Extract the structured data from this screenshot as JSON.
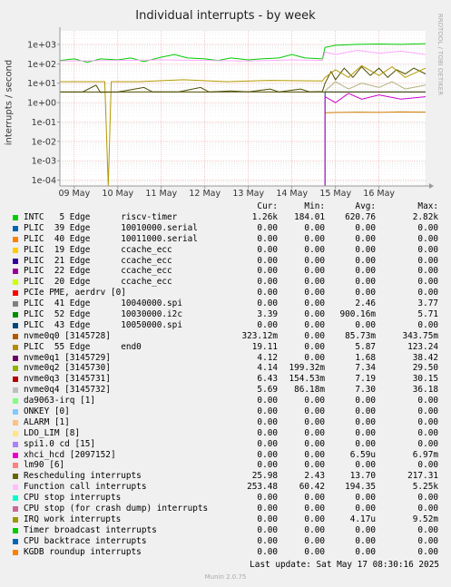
{
  "chart_data": {
    "type": "line",
    "title": "Individual interrupts - by week",
    "ylabel": "interrupts / second",
    "y_scale": "log",
    "ylim": [
      5e-05,
      5000
    ],
    "y_ticks": [
      {
        "v": 1000,
        "label": "1e+03"
      },
      {
        "v": 100,
        "label": "1e+02"
      },
      {
        "v": 10,
        "label": "1e+01"
      },
      {
        "v": 1,
        "label": "1e+00"
      },
      {
        "v": 0.1,
        "label": "1e-01"
      },
      {
        "v": 0.01,
        "label": "1e-02"
      },
      {
        "v": 0.001,
        "label": "1e-03"
      },
      {
        "v": 0.0001,
        "label": "1e-04"
      }
    ],
    "xlim": [
      -0.33,
      8.07
    ],
    "x_ticks": [
      {
        "v": 0,
        "label": "09 May"
      },
      {
        "v": 1,
        "label": "10 May"
      },
      {
        "v": 2,
        "label": "11 May"
      },
      {
        "v": 3,
        "label": "12 May"
      },
      {
        "v": 4,
        "label": "13 May"
      },
      {
        "v": 5,
        "label": "14 May"
      },
      {
        "v": 6,
        "label": "15 May"
      },
      {
        "v": 7,
        "label": "16 May"
      }
    ],
    "grid": true,
    "series": [
      {
        "name": "Rescheduling interrupts",
        "color": "#4d4d00",
        "points": [
          [
            -0.33,
            3.5
          ],
          [
            0.2,
            3.6
          ],
          [
            0.5,
            8
          ],
          [
            0.6,
            3.4
          ],
          [
            1,
            3.5
          ],
          [
            1.6,
            6
          ],
          [
            1.8,
            3.5
          ],
          [
            2.4,
            3.6
          ],
          [
            2.9,
            6
          ],
          [
            3.1,
            3.5
          ],
          [
            3.6,
            4
          ],
          [
            4,
            3.6
          ],
          [
            4.5,
            5
          ],
          [
            4.7,
            3.5
          ],
          [
            5.2,
            5
          ],
          [
            5.4,
            3.6
          ],
          [
            5.7,
            3.7
          ],
          [
            5.76,
            10
          ],
          [
            5.9,
            40
          ],
          [
            6.0,
            15
          ],
          [
            6.2,
            60
          ],
          [
            6.4,
            20
          ],
          [
            6.6,
            70
          ],
          [
            6.8,
            25
          ],
          [
            7.0,
            60
          ],
          [
            7.2,
            20
          ],
          [
            7.4,
            50
          ],
          [
            7.6,
            30
          ],
          [
            7.8,
            60
          ],
          [
            8.07,
            30
          ]
        ]
      },
      {
        "name": "INTC 5 Edge riscv-timer",
        "color": "#00cc00",
        "points": [
          [
            -0.33,
            150
          ],
          [
            0,
            180
          ],
          [
            0.3,
            120
          ],
          [
            0.6,
            180
          ],
          [
            1,
            160
          ],
          [
            1.3,
            200
          ],
          [
            1.6,
            130
          ],
          [
            2,
            220
          ],
          [
            2.3,
            300
          ],
          [
            2.6,
            200
          ],
          [
            3,
            180
          ],
          [
            3.3,
            150
          ],
          [
            3.6,
            200
          ],
          [
            4,
            160
          ],
          [
            4.3,
            180
          ],
          [
            4.7,
            200
          ],
          [
            5,
            300
          ],
          [
            5.3,
            200
          ],
          [
            5.7,
            180
          ],
          [
            5.76,
            700
          ],
          [
            6,
            900
          ],
          [
            6.5,
            1000
          ],
          [
            7,
            1050
          ],
          [
            7.5,
            1000
          ],
          [
            8.07,
            1100
          ]
        ]
      },
      {
        "name": "Function call interrupts",
        "color": "#ffa8ff",
        "points": [
          [
            -0.33,
            140
          ],
          [
            1,
            150
          ],
          [
            2,
            160
          ],
          [
            3,
            150
          ],
          [
            4,
            140
          ],
          [
            5,
            160
          ],
          [
            5.7,
            150
          ],
          [
            5.76,
            400
          ],
          [
            6,
            300
          ],
          [
            6.5,
            500
          ],
          [
            7,
            350
          ],
          [
            7.5,
            450
          ],
          [
            8.07,
            300
          ]
        ]
      },
      {
        "name": "nvme0q2 [3145730]",
        "color": "#b0b07a",
        "points": [
          [
            5.76,
            4
          ],
          [
            6,
            12
          ],
          [
            6.3,
            5
          ],
          [
            6.6,
            10
          ],
          [
            7,
            6
          ],
          [
            7.3,
            12
          ],
          [
            7.6,
            5
          ],
          [
            8.07,
            8
          ]
        ]
      },
      {
        "name": "nvme0q0 [3145728]",
        "color": "#cc7a00",
        "points": [
          [
            5.76,
            0.3
          ],
          [
            6.5,
            0.32
          ],
          [
            7,
            0.31
          ],
          [
            7.5,
            0.33
          ],
          [
            8.07,
            0.32
          ]
        ]
      },
      {
        "name": "PLIC 43 Edge 10050000.spi",
        "color": "#004080",
        "points": [
          [
            5.76,
            5e-05
          ],
          [
            5.76,
            3.5
          ],
          [
            8.07,
            3.5
          ]
        ]
      },
      {
        "name": "nvme0q1 [3145729]",
        "color": "#cc00cc",
        "points": [
          [
            5.76,
            5e-05
          ],
          [
            5.76,
            2
          ],
          [
            6,
            1
          ],
          [
            6.3,
            3
          ],
          [
            6.6,
            1.5
          ],
          [
            7,
            2.5
          ],
          [
            7.5,
            1.5
          ],
          [
            8.07,
            2
          ]
        ]
      },
      {
        "name": "PLIC 55 Edge end0",
        "color": "#b39a00",
        "points": [
          [
            -0.33,
            12
          ],
          [
            0.7,
            12
          ],
          [
            0.78,
            5e-05
          ],
          [
            0.85,
            12
          ],
          [
            1.5,
            12
          ],
          [
            2.5,
            15
          ],
          [
            3.5,
            12
          ],
          [
            4.5,
            14
          ],
          [
            5.7,
            13
          ],
          [
            5.76,
            20
          ],
          [
            6,
            50
          ],
          [
            6.3,
            20
          ],
          [
            6.6,
            80
          ],
          [
            7,
            25
          ],
          [
            7.3,
            70
          ],
          [
            7.6,
            20
          ],
          [
            8.07,
            60
          ]
        ]
      },
      {
        "name": "PLIC 39 Edge 10010000.serial",
        "color": "#4d4d00",
        "points": [
          [
            -0.33,
            3.5
          ],
          [
            1,
            3.5
          ],
          [
            2,
            3.6
          ],
          [
            3,
            3.5
          ],
          [
            4,
            3.6
          ],
          [
            5,
            3.5
          ],
          [
            5.76,
            3.5
          ],
          [
            8.07,
            3.5
          ]
        ]
      }
    ],
    "legend_header": {
      "cur": "Cur:",
      "min": "Min:",
      "avg": "Avg:",
      "max": "Max:"
    },
    "legend": [
      {
        "name": "INTC   5 Edge      riscv-timer",
        "color": "#00cc00",
        "cur": "1.26k",
        "min": "184.01",
        "avg": "620.76",
        "max": "2.82k"
      },
      {
        "name": "PLIC  39 Edge      10010000.serial",
        "color": "#0066b3",
        "cur": "0.00",
        "min": "0.00",
        "avg": "0.00",
        "max": "0.00"
      },
      {
        "name": "PLIC  40 Edge      10011000.serial",
        "color": "#ff8000",
        "cur": "0.00",
        "min": "0.00",
        "avg": "0.00",
        "max": "0.00"
      },
      {
        "name": "PLIC  19 Edge      ccache_ecc",
        "color": "#ffcc00",
        "cur": "0.00",
        "min": "0.00",
        "avg": "0.00",
        "max": "0.00"
      },
      {
        "name": "PLIC  21 Edge      ccache_ecc",
        "color": "#330099",
        "cur": "0.00",
        "min": "0.00",
        "avg": "0.00",
        "max": "0.00"
      },
      {
        "name": "PLIC  22 Edge      ccache_ecc",
        "color": "#990099",
        "cur": "0.00",
        "min": "0.00",
        "avg": "0.00",
        "max": "0.00"
      },
      {
        "name": "PLIC  20 Edge      ccache_ecc",
        "color": "#ccff00",
        "cur": "0.00",
        "min": "0.00",
        "avg": "0.00",
        "max": "0.00"
      },
      {
        "name": "PCIe PME, aerdrv [0]",
        "color": "#ff0000",
        "cur": "0.00",
        "min": "0.00",
        "avg": "0.00",
        "max": "0.00"
      },
      {
        "name": "PLIC  41 Edge      10040000.spi",
        "color": "#808080",
        "cur": "0.00",
        "min": "0.00",
        "avg": "2.46",
        "max": "3.77"
      },
      {
        "name": "PLIC  52 Edge      10030000.i2c",
        "color": "#008f00",
        "cur": "3.39",
        "min": "0.00",
        "avg": "900.16m",
        "max": "5.71"
      },
      {
        "name": "PLIC  43 Edge      10050000.spi",
        "color": "#00487d",
        "cur": "0.00",
        "min": "0.00",
        "avg": "0.00",
        "max": "0.00"
      },
      {
        "name": "nvme0q0 [3145728]",
        "color": "#b35a00",
        "cur": "323.12m",
        "min": "0.00",
        "avg": "85.73m",
        "max": "343.75m"
      },
      {
        "name": "PLIC  55 Edge      end0",
        "color": "#b38f00",
        "cur": "19.11",
        "min": "0.00",
        "avg": "5.87",
        "max": "123.24"
      },
      {
        "name": "nvme0q1 [3145729]",
        "color": "#6b006b",
        "cur": "4.12",
        "min": "0.00",
        "avg": "1.68",
        "max": "38.42"
      },
      {
        "name": "nvme0q2 [3145730]",
        "color": "#8fb300",
        "cur": "4.14",
        "min": "199.32m",
        "avg": "7.34",
        "max": "29.50"
      },
      {
        "name": "nvme0q3 [3145731]",
        "color": "#b30000",
        "cur": "6.43",
        "min": "154.53m",
        "avg": "7.19",
        "max": "30.15"
      },
      {
        "name": "nvme0q4 [3145732]",
        "color": "#bebebe",
        "cur": "5.69",
        "min": "86.18m",
        "avg": "7.30",
        "max": "36.18"
      },
      {
        "name": "da9063-irq [1]",
        "color": "#80ff80",
        "cur": "0.00",
        "min": "0.00",
        "avg": "0.00",
        "max": "0.00"
      },
      {
        "name": "ONKEY [0]",
        "color": "#80c9ff",
        "cur": "0.00",
        "min": "0.00",
        "avg": "0.00",
        "max": "0.00"
      },
      {
        "name": "ALARM [1]",
        "color": "#ffc080",
        "cur": "0.00",
        "min": "0.00",
        "avg": "0.00",
        "max": "0.00"
      },
      {
        "name": "LDO_LIM [8]",
        "color": "#ffe680",
        "cur": "0.00",
        "min": "0.00",
        "avg": "0.00",
        "max": "0.00"
      },
      {
        "name": "spi1.0 cd [15]",
        "color": "#aa80ff",
        "cur": "0.00",
        "min": "0.00",
        "avg": "0.00",
        "max": "0.00"
      },
      {
        "name": "xhci_hcd [2097152]",
        "color": "#ee00cc",
        "cur": "0.00",
        "min": "0.00",
        "avg": "6.59u",
        "max": "6.97m"
      },
      {
        "name": "lm90 [6]",
        "color": "#ff8080",
        "cur": "0.00",
        "min": "0.00",
        "avg": "0.00",
        "max": "0.00"
      },
      {
        "name": "Rescheduling interrupts",
        "color": "#666600",
        "cur": "25.98",
        "min": "2.43",
        "avg": "13.70",
        "max": "217.31"
      },
      {
        "name": "Function call interrupts",
        "color": "#ffbfff",
        "cur": "253.48",
        "min": "60.42",
        "avg": "194.35",
        "max": "5.25k"
      },
      {
        "name": "CPU stop interrupts",
        "color": "#00ffcc",
        "cur": "0.00",
        "min": "0.00",
        "avg": "0.00",
        "max": "0.00"
      },
      {
        "name": "CPU stop (for crash dump) interrupts",
        "color": "#cc6699",
        "cur": "0.00",
        "min": "0.00",
        "avg": "0.00",
        "max": "0.00"
      },
      {
        "name": "IRQ work interrupts",
        "color": "#999900",
        "cur": "0.00",
        "min": "0.00",
        "avg": "4.17u",
        "max": "9.52m"
      },
      {
        "name": "Timer broadcast interrupts",
        "color": "#00cc00",
        "cur": "0.00",
        "min": "0.00",
        "avg": "0.00",
        "max": "0.00"
      },
      {
        "name": "CPU backtrace interrupts",
        "color": "#0066b3",
        "cur": "0.00",
        "min": "0.00",
        "avg": "0.00",
        "max": "0.00"
      },
      {
        "name": "KGDB roundup interrupts",
        "color": "#ff8000",
        "cur": "0.00",
        "min": "0.00",
        "avg": "0.00",
        "max": "0.00"
      }
    ]
  },
  "side_label": "RRDTOOL / TOBI OETIKER",
  "last_update": "Last update: Sat May 17 08:30:16 2025",
  "footer": "Munin 2.0.75"
}
